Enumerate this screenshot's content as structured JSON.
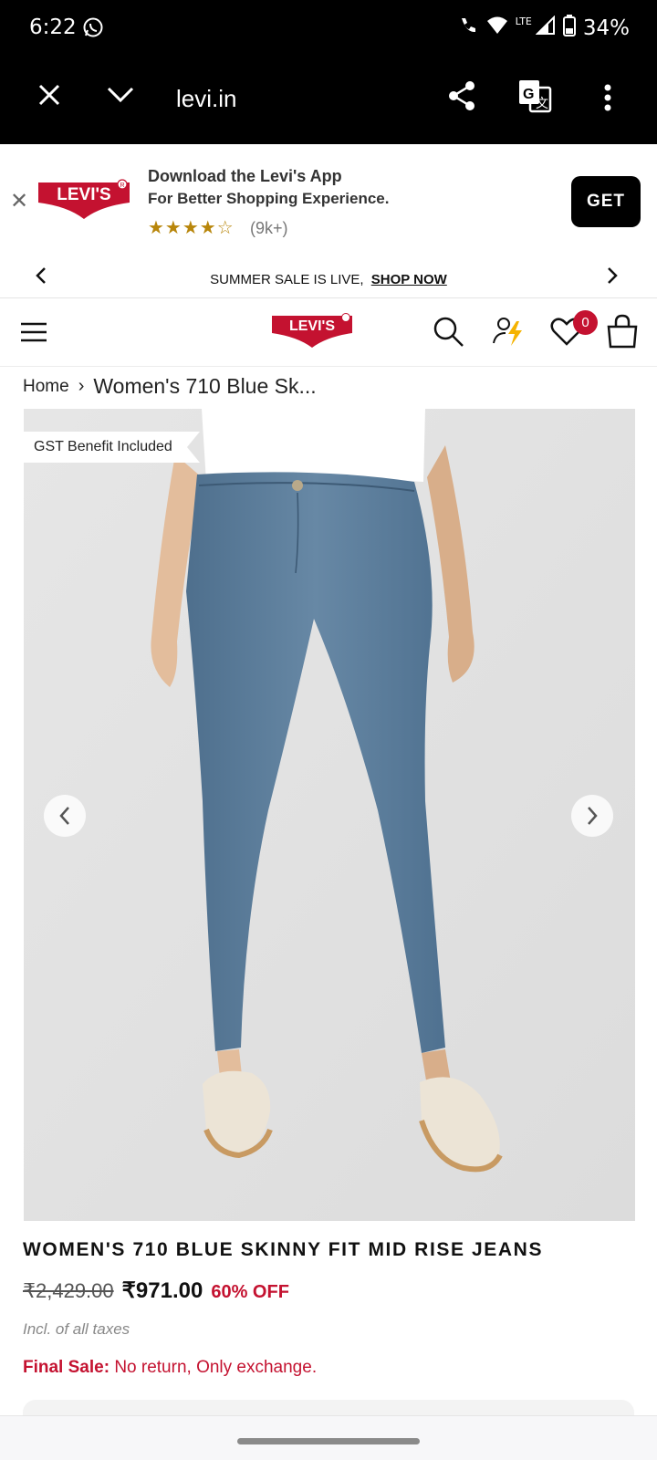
{
  "status_bar": {
    "time": "6:22",
    "network": "LTE",
    "battery": "34%"
  },
  "browser": {
    "url": "levi.in"
  },
  "app_banner": {
    "brand": "LEVI'S",
    "title": "Download the Levi's App",
    "subtitle": "For Better Shopping Experience.",
    "stars": "★★★★☆",
    "rating_value": 4.5,
    "reviews": "(9k+)",
    "cta": "GET"
  },
  "promo": {
    "text": "SUMMER SALE IS LIVE,",
    "link": "SHOP NOW"
  },
  "nav": {
    "brand": "LEVI'S",
    "wishlist_count": "0"
  },
  "breadcrumb": {
    "home": "Home",
    "separator": "›",
    "current": "Women's 710 Blue Sk..."
  },
  "product": {
    "tag": "GST Benefit Included",
    "title": "WOMEN'S 710 BLUE SKINNY FIT MID RISE JEANS",
    "mrp": "₹2,429.00",
    "price": "₹971.00",
    "discount": "60% OFF",
    "taxes": "Incl. of all taxes",
    "final_sale_label": "Final Sale:",
    "final_sale_text": "No return, Only exchange."
  },
  "colors": {
    "brand_red": "#c41230",
    "denim": "#5e7f9c",
    "star_gold": "#b8860b"
  }
}
